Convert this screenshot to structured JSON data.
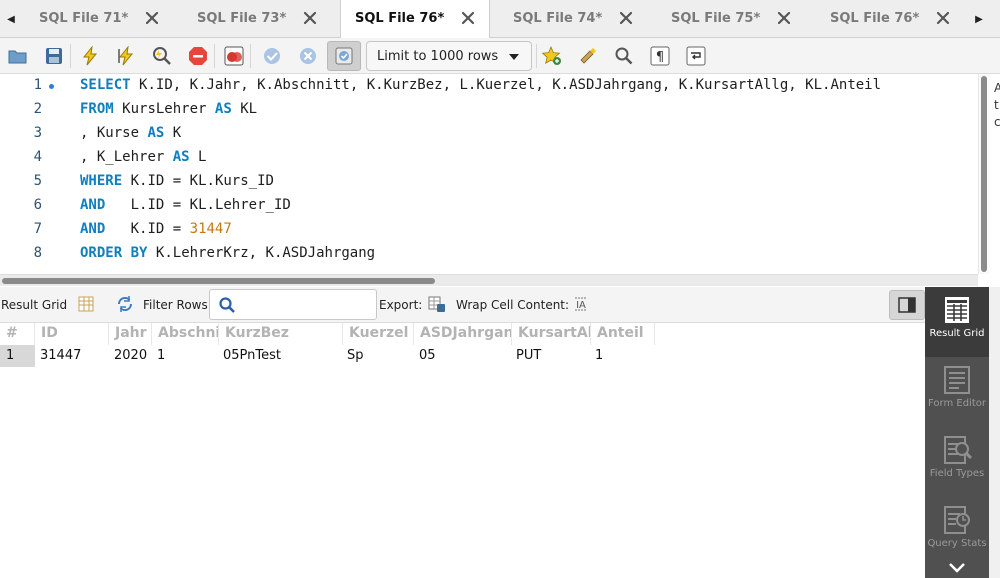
{
  "tabs": [
    {
      "label": "SQL File 71*",
      "active": false
    },
    {
      "label": "SQL File 73*",
      "active": false
    },
    {
      "label": "SQL File 76*",
      "active": true
    },
    {
      "label": "SQL File 74*",
      "active": false
    },
    {
      "label": "SQL File 75*",
      "active": false
    },
    {
      "label": "SQL File 76*",
      "active": false
    }
  ],
  "toolbar": {
    "icons": [
      "open-folder-icon",
      "save-icon",
      "execute-icon",
      "execute-current-icon",
      "explain-icon",
      "stop-icon",
      "stop-on-error-icon",
      "commit-icon",
      "rollback-icon",
      "autocommit-icon",
      "bookmark-icon",
      "beautify-icon",
      "find-icon",
      "invisible-chars-icon",
      "wrap-icon"
    ],
    "limit_label": "Limit to 1000 rows"
  },
  "editor": {
    "lines": [
      {
        "no": "1",
        "code": "SELECT K.ID, K.Jahr, K.Abschnitt, K.KurzBez, L.Kuerzel, K.ASDJahrgang, K.KursartAllg, KL.Anteil"
      },
      {
        "no": "2",
        "code": "FROM KursLehrer AS KL"
      },
      {
        "no": "3",
        "code": ", Kurse AS K"
      },
      {
        "no": "4",
        "code": ", K_Lehrer AS L"
      },
      {
        "no": "5",
        "code": "WHERE K.ID = KL.Kurs_ID"
      },
      {
        "no": "6",
        "code": "AND   L.ID = KL.Lehrer_ID"
      },
      {
        "no": "7",
        "code": "AND   K.ID = 31447"
      },
      {
        "no": "8",
        "code": "ORDER BY K.LehrerKrz, K.ASDJahrgang"
      }
    ],
    "right_pane_text": "A t c"
  },
  "result_toolbar": {
    "result_grid_label": "Result Grid",
    "filter_rows_label": "Filter Rows:",
    "filter_value": "",
    "export_label": "Export:",
    "wrap_label": "Wrap Cell Content:"
  },
  "grid": {
    "columns": [
      "#",
      "ID",
      "Jahr",
      "Abschnitt",
      "KurzBez",
      "Kuerzel",
      "ASDJahrgang",
      "KursartAllg",
      "Anteil"
    ],
    "rows": [
      [
        "1",
        "31447",
        "2020",
        "1",
        "05PnTest",
        "Sp",
        "05",
        "PUT",
        "1"
      ]
    ]
  },
  "side_panel": {
    "buttons": [
      {
        "label": "Result Grid",
        "active": true
      },
      {
        "label": "Form Editor",
        "active": false
      },
      {
        "label": "Field Types",
        "active": false
      },
      {
        "label": "Query Stats",
        "active": false
      }
    ]
  },
  "colors": {
    "keyword": "#0f7fbf",
    "number": "#c47a10",
    "line_number": "#2a5478",
    "side_panel_bg": "#505050"
  }
}
